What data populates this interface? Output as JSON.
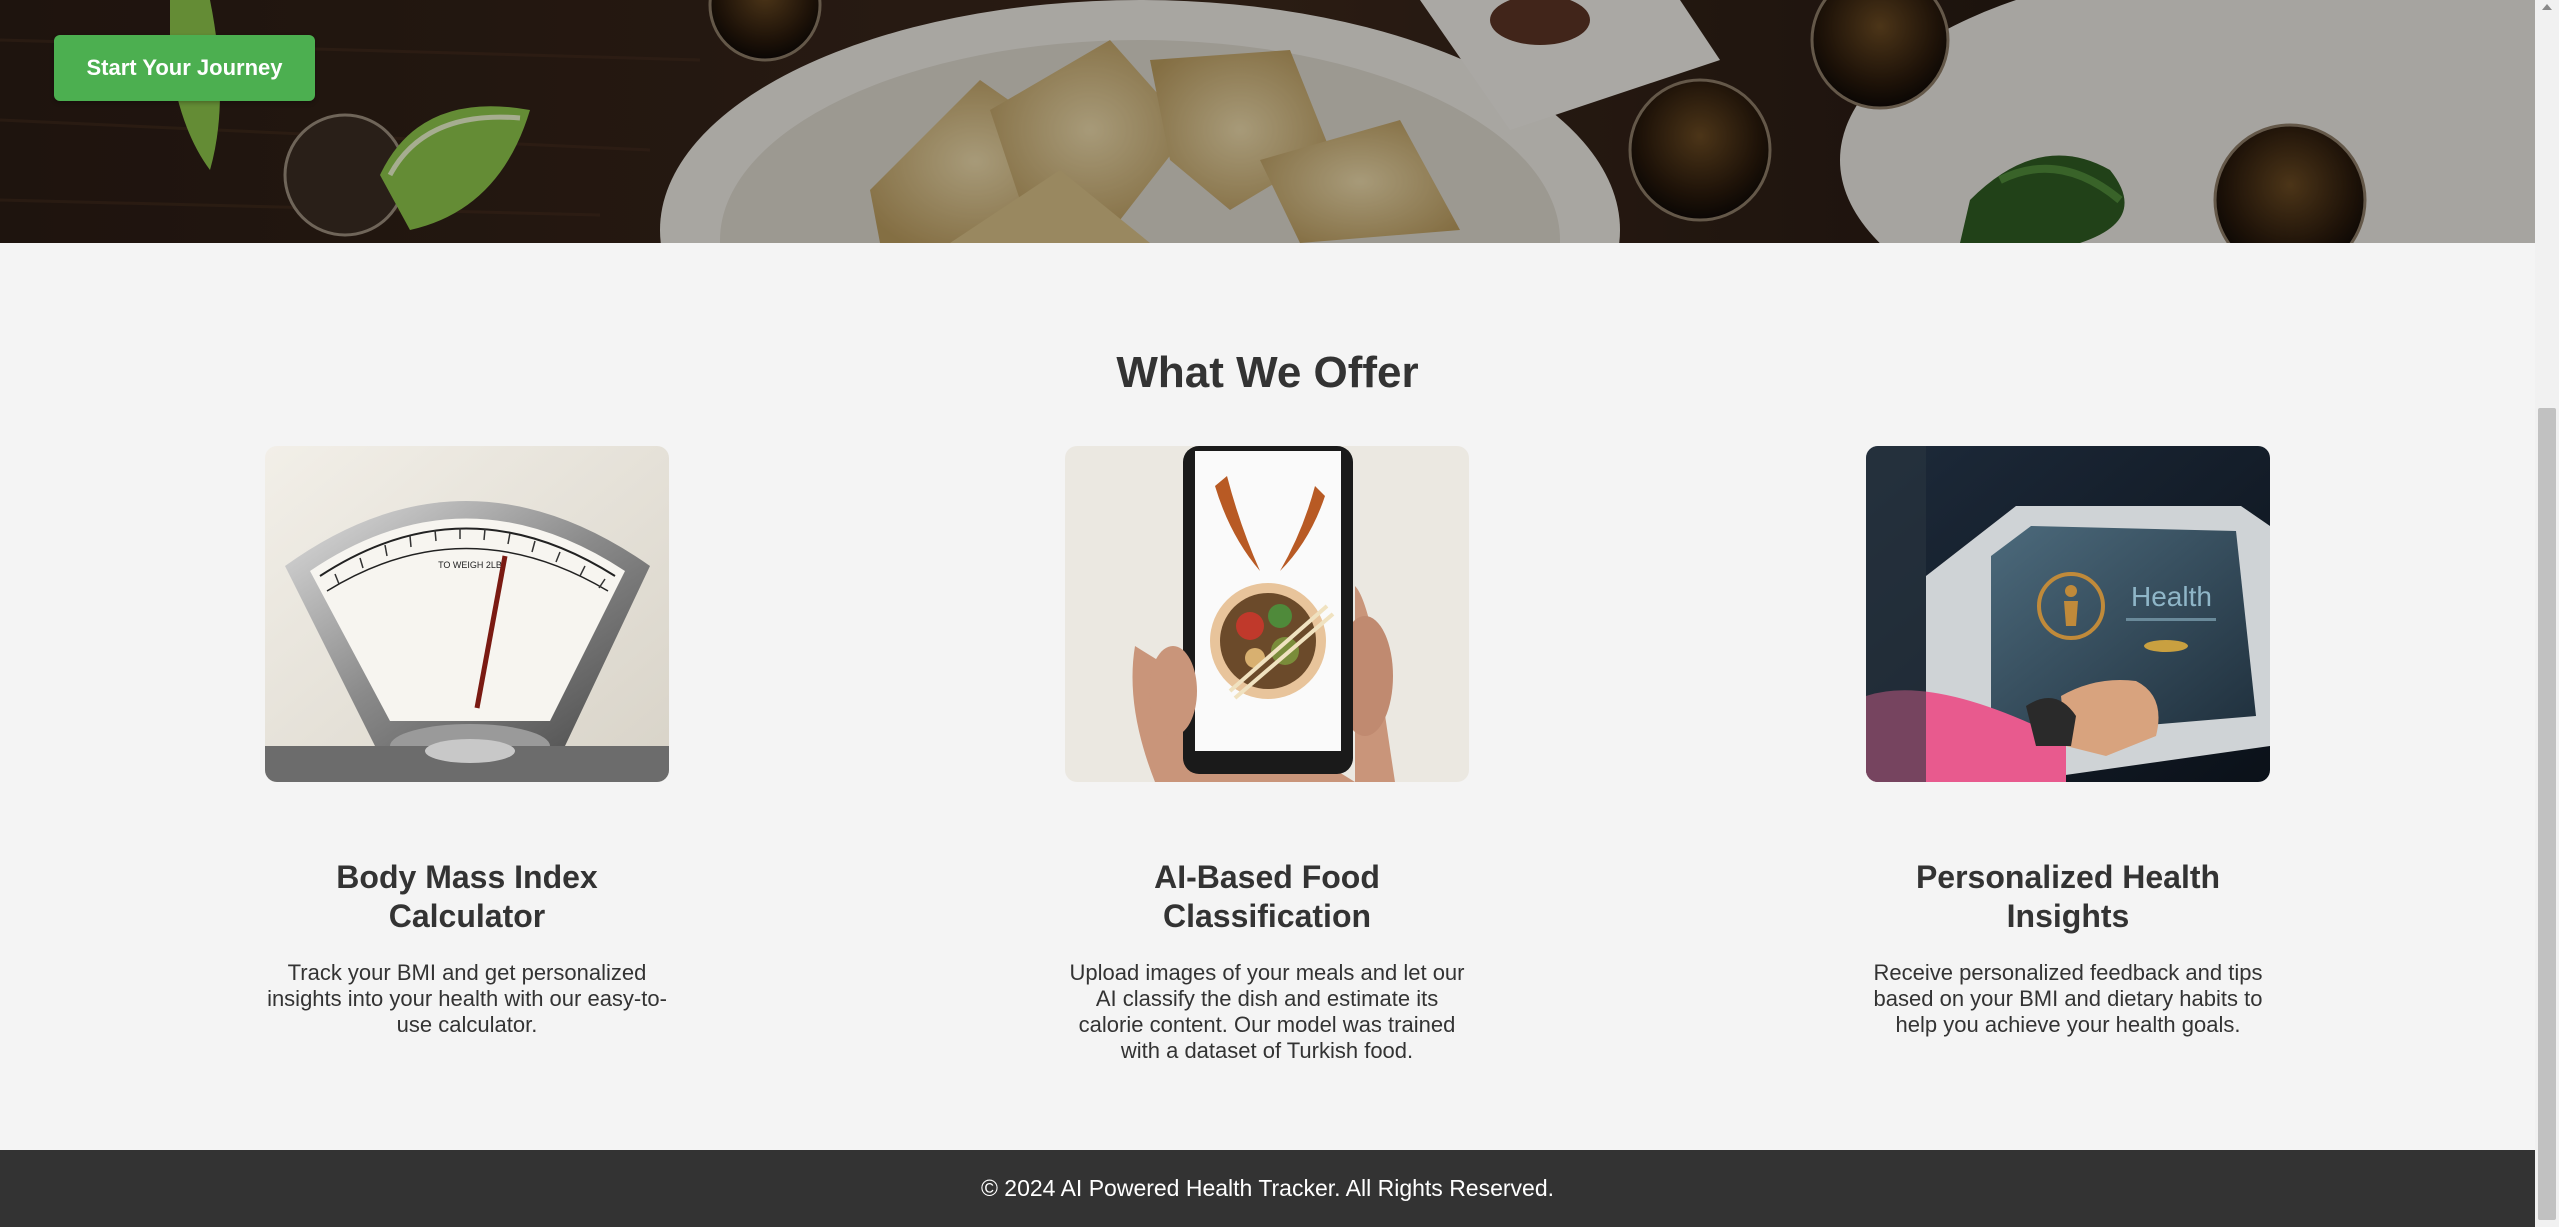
{
  "hero": {
    "cta_label": "Start Your Journey"
  },
  "offers": {
    "title": "What We Offer",
    "cards": [
      {
        "title": "Body Mass Index Calculator",
        "description": "Track your BMI and get personalized insights into your health with our easy-to-use calculator.",
        "image_icon": "weighing-scale-icon"
      },
      {
        "title": "AI-Based Food Classification",
        "description": "Upload images of your meals and let our AI classify the dish and estimate its calorie content. Our model was trained with a dataset of Turkish food.",
        "image_icon": "smartphone-food-icon"
      },
      {
        "title": "Personalized Health Insights",
        "description": "Receive personalized feedback and tips based on your BMI and dietary habits to help you achieve your health goals.",
        "image_icon": "health-screen-icon"
      }
    ]
  },
  "scale_image": {
    "dial_text": "TO WEIGH 2LB"
  },
  "health_image": {
    "screen_text": "Health"
  },
  "footer": {
    "copyright": "© 2024 AI Powered Health Tracker. All Rights Reserved."
  },
  "colors": {
    "accent": "#4caf50",
    "section_bg": "#f4f4f4",
    "footer_bg": "#333333",
    "text": "#333333"
  }
}
